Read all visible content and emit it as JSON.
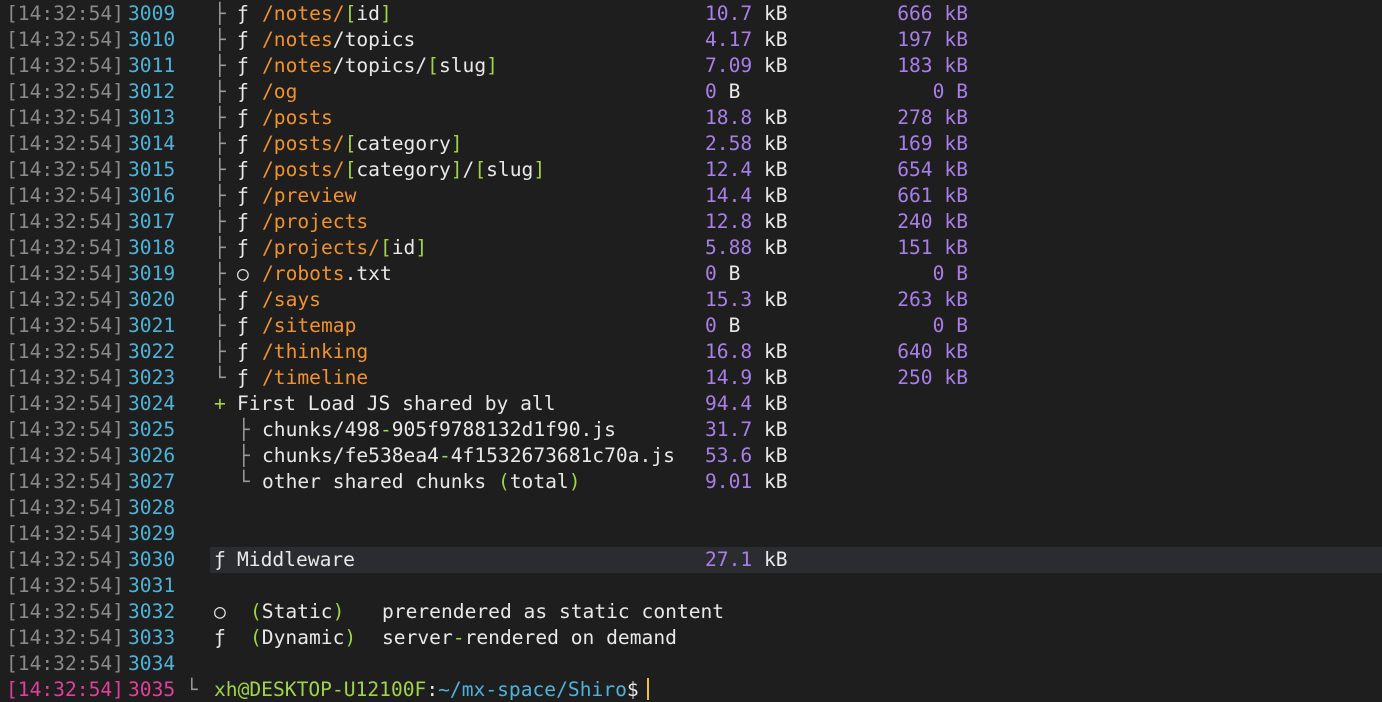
{
  "rows": [
    {
      "ts": "[14:32:54]",
      "ln": "3009",
      "tree": "├",
      "sym": "ƒ",
      "route": [
        [
          "/notes/",
          "o"
        ],
        [
          "[",
          "g"
        ],
        [
          "id",
          "w"
        ],
        [
          "]",
          "g"
        ]
      ],
      "size": "10.7",
      "unit": "kB",
      "first": "666 kB"
    },
    {
      "ts": "[14:32:54]",
      "ln": "3010",
      "tree": "├",
      "sym": "ƒ",
      "route": [
        [
          "/notes",
          "o"
        ],
        [
          "/topics",
          "w"
        ]
      ],
      "size": "4.17",
      "unit": "kB",
      "first": "197 kB"
    },
    {
      "ts": "[14:32:54]",
      "ln": "3011",
      "tree": "├",
      "sym": "ƒ",
      "route": [
        [
          "/notes",
          "o"
        ],
        [
          "/topics/",
          "w"
        ],
        [
          "[",
          "g"
        ],
        [
          "slug",
          "w"
        ],
        [
          "]",
          "g"
        ]
      ],
      "size": "7.09",
      "unit": "kB",
      "first": "183 kB"
    },
    {
      "ts": "[14:32:54]",
      "ln": "3012",
      "tree": "├",
      "sym": "ƒ",
      "route": [
        [
          "/og",
          "o"
        ]
      ],
      "size": "0",
      "unit": "B",
      "first": "0 B"
    },
    {
      "ts": "[14:32:54]",
      "ln": "3013",
      "tree": "├",
      "sym": "ƒ",
      "route": [
        [
          "/posts",
          "o"
        ]
      ],
      "size": "18.8",
      "unit": "kB",
      "first": "278 kB"
    },
    {
      "ts": "[14:32:54]",
      "ln": "3014",
      "tree": "├",
      "sym": "ƒ",
      "route": [
        [
          "/posts/",
          "o"
        ],
        [
          "[",
          "g"
        ],
        [
          "category",
          "w"
        ],
        [
          "]",
          "g"
        ]
      ],
      "size": "2.58",
      "unit": "kB",
      "first": "169 kB"
    },
    {
      "ts": "[14:32:54]",
      "ln": "3015",
      "tree": "├",
      "sym": "ƒ",
      "route": [
        [
          "/posts/",
          "o"
        ],
        [
          "[",
          "g"
        ],
        [
          "category",
          "w"
        ],
        [
          "]",
          "g"
        ],
        [
          "/",
          "w"
        ],
        [
          "[",
          "g"
        ],
        [
          "slug",
          "w"
        ],
        [
          "]",
          "g"
        ]
      ],
      "size": "12.4",
      "unit": "kB",
      "first": "654 kB"
    },
    {
      "ts": "[14:32:54]",
      "ln": "3016",
      "tree": "├",
      "sym": "ƒ",
      "route": [
        [
          "/preview",
          "o"
        ]
      ],
      "size": "14.4",
      "unit": "kB",
      "first": "661 kB"
    },
    {
      "ts": "[14:32:54]",
      "ln": "3017",
      "tree": "├",
      "sym": "ƒ",
      "route": [
        [
          "/projects",
          "o"
        ]
      ],
      "size": "12.8",
      "unit": "kB",
      "first": "240 kB"
    },
    {
      "ts": "[14:32:54]",
      "ln": "3018",
      "tree": "├",
      "sym": "ƒ",
      "route": [
        [
          "/projects/",
          "o"
        ],
        [
          "[",
          "g"
        ],
        [
          "id",
          "w"
        ],
        [
          "]",
          "g"
        ]
      ],
      "size": "5.88",
      "unit": "kB",
      "first": "151 kB"
    },
    {
      "ts": "[14:32:54]",
      "ln": "3019",
      "tree": "├",
      "sym": "○",
      "route": [
        [
          "/robots",
          "o"
        ],
        [
          ".txt",
          "w"
        ]
      ],
      "size": "0",
      "unit": "B",
      "first": "0 B"
    },
    {
      "ts": "[14:32:54]",
      "ln": "3020",
      "tree": "├",
      "sym": "ƒ",
      "route": [
        [
          "/says",
          "o"
        ]
      ],
      "size": "15.3",
      "unit": "kB",
      "first": "263 kB"
    },
    {
      "ts": "[14:32:54]",
      "ln": "3021",
      "tree": "├",
      "sym": "ƒ",
      "route": [
        [
          "/sitemap",
          "o"
        ]
      ],
      "size": "0",
      "unit": "B",
      "first": "0 B"
    },
    {
      "ts": "[14:32:54]",
      "ln": "3022",
      "tree": "├",
      "sym": "ƒ",
      "route": [
        [
          "/thinking",
          "o"
        ]
      ],
      "size": "16.8",
      "unit": "kB",
      "first": "640 kB"
    },
    {
      "ts": "[14:32:54]",
      "ln": "3023",
      "tree": "└",
      "sym": "ƒ",
      "route": [
        [
          "/timeline",
          "o"
        ]
      ],
      "size": "14.9",
      "unit": "kB",
      "first": "250 kB"
    }
  ],
  "shared": {
    "ts": "[14:32:54]",
    "ln": "3024",
    "plus": "+",
    "label": "First Load JS shared by all",
    "size": "94.4",
    "unit": "kB"
  },
  "chunks": [
    {
      "ts": "[14:32:54]",
      "ln": "3025",
      "tree": "├",
      "name_a": "chunks/498",
      "dash": "-",
      "name_b": "905f9788132d1f90.js",
      "size": "31.7",
      "unit": "kB"
    },
    {
      "ts": "[14:32:54]",
      "ln": "3026",
      "tree": "├",
      "name_a": "chunks/fe538ea4",
      "dash": "-",
      "name_b": "4f1532673681c70a.js",
      "size": "53.6",
      "unit": "kB"
    },
    {
      "ts": "[14:32:54]",
      "ln": "3027",
      "tree": "└",
      "name_a": "other shared chunks ",
      "paren_open": "(",
      "name_b": "total",
      "paren_close": ")",
      "size": "9.01",
      "unit": "kB"
    }
  ],
  "blank_rows": [
    {
      "ts": "[14:32:54]",
      "ln": "3028"
    },
    {
      "ts": "[14:32:54]",
      "ln": "3029"
    }
  ],
  "middleware": {
    "ts": "[14:32:54]",
    "ln": "3030",
    "sym": "ƒ",
    "label": "Middleware",
    "size": "27.1",
    "unit": "kB"
  },
  "blank_row_3031": {
    "ts": "[14:32:54]",
    "ln": "3031"
  },
  "legend": [
    {
      "ts": "[14:32:54]",
      "ln": "3032",
      "sym": "○",
      "open": "(",
      "label": "Static",
      "close": ")",
      "desc_a": "prerendered as static content",
      "desc_dash": "",
      "desc_b": ""
    },
    {
      "ts": "[14:32:54]",
      "ln": "3033",
      "sym": "ƒ",
      "open": "(",
      "label": "Dynamic",
      "close": ")",
      "desc_a": "server",
      "desc_dash": "-",
      "desc_b": "rendered on demand"
    }
  ],
  "blank_row_3034": {
    "ts": "[14:32:54]",
    "ln": "3034"
  },
  "prompt_row": {
    "ts": "[14:32:54]",
    "ln": "3035",
    "tree": "└",
    "user": "xh@DESKTOP-U12100F",
    "colon": ":",
    "path": "~/mx-space/Shiro",
    "dollar": "$"
  }
}
